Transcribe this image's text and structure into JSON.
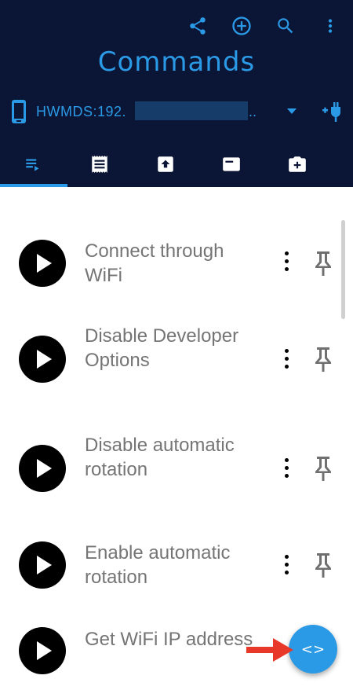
{
  "header": {
    "title": "Commands",
    "actions": [
      "share-icon",
      "add-circle-icon",
      "search-icon",
      "more-vert-icon"
    ],
    "device": {
      "prefix": "HWMDS:192.",
      "suffix": "..",
      "redacted": true
    }
  },
  "tabs": [
    {
      "icon": "playlist-play-icon",
      "active": true
    },
    {
      "icon": "receipt-icon",
      "active": false
    },
    {
      "icon": "upload-icon",
      "active": false
    },
    {
      "icon": "window-icon",
      "active": false
    },
    {
      "icon": "camera-add-icon",
      "active": false
    }
  ],
  "commands": [
    {
      "label": "Connect through WiFi"
    },
    {
      "label": "Disable Developer Options"
    },
    {
      "label": "Disable automatic rotation"
    },
    {
      "label": "Enable automatic rotation"
    },
    {
      "label": "Get WiFi IP address"
    }
  ],
  "fab": {
    "label": "<>"
  },
  "colors": {
    "header_bg": "#0b1535",
    "accent": "#2b9ae6",
    "text_gray": "#757575",
    "annotation": "#e8382a"
  }
}
